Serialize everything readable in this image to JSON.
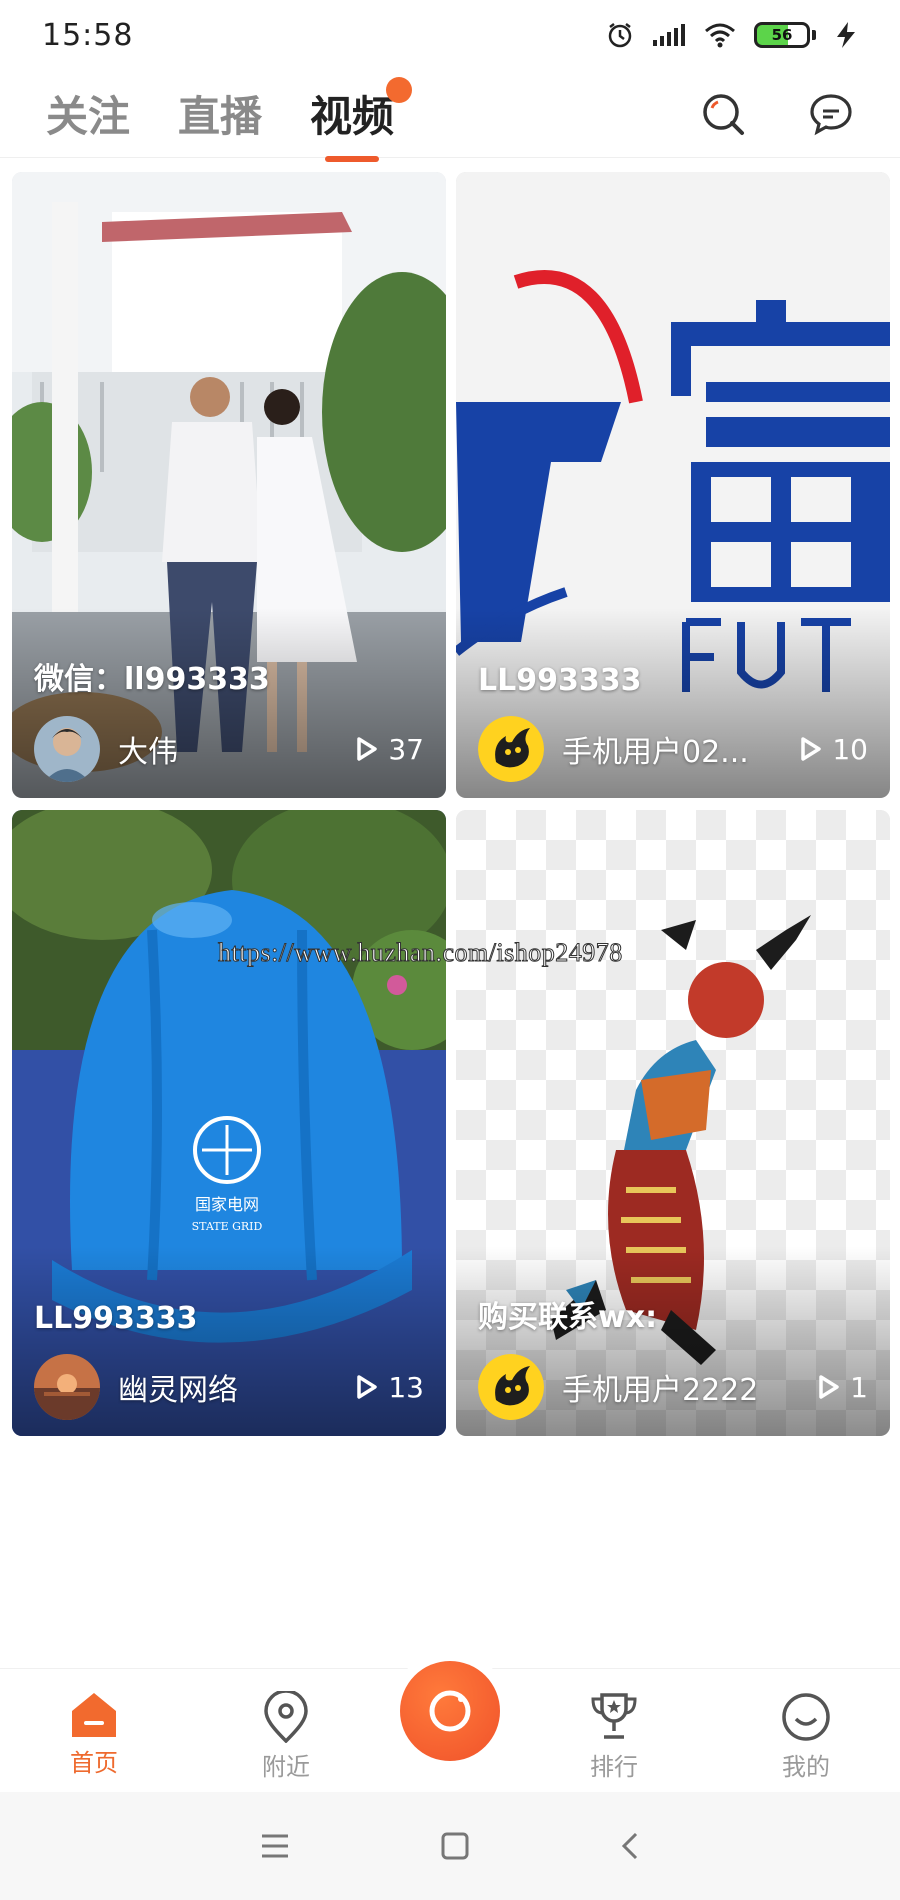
{
  "status_bar": {
    "time": "15:58",
    "battery_level": "56",
    "icons": [
      "alarm-icon",
      "signal-icon",
      "wifi-icon",
      "battery-icon",
      "charging-icon"
    ]
  },
  "top_nav": {
    "tabs": [
      {
        "label": "关注",
        "active": false
      },
      {
        "label": "直播",
        "active": false
      },
      {
        "label": "视频",
        "active": true
      }
    ],
    "actions": [
      "search-icon",
      "message-icon"
    ],
    "accent": "#ee5a2c"
  },
  "videos": [
    {
      "title": "微信：ll993333",
      "author": "大伟",
      "views": "37",
      "avatar": "photo-avatar"
    },
    {
      "title": "LL993333",
      "author": "手机用户02...",
      "views": "10",
      "avatar": "flame-avatar"
    },
    {
      "title": "LL993333",
      "author": "幽灵网络",
      "views": "13",
      "avatar": "sunset-avatar"
    },
    {
      "title": "购买联系wx:",
      "author": "手机用户2222",
      "views": "1",
      "avatar": "flame-avatar"
    }
  ],
  "watermark": "https://www.huzhan.com/ishop24978",
  "tab_bar": {
    "items": [
      {
        "label": "首页",
        "icon": "home-icon",
        "active": true
      },
      {
        "label": "附近",
        "icon": "location-icon",
        "active": false
      },
      {
        "label": "",
        "icon": "camera-icon",
        "active": false
      },
      {
        "label": "排行",
        "icon": "trophy-icon",
        "active": false
      },
      {
        "label": "我的",
        "icon": "profile-icon",
        "active": false
      }
    ],
    "active_color": "#ee6a2e"
  },
  "system_nav": [
    "menu-icon",
    "home-square-icon",
    "back-icon"
  ]
}
